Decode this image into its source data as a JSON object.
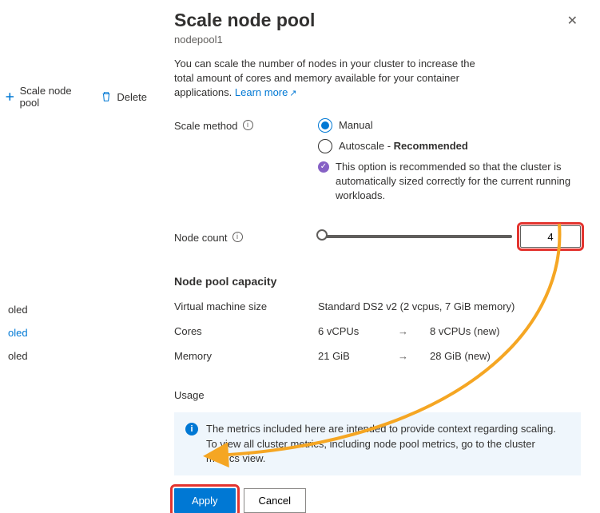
{
  "left": {
    "scale_btn": "Scale node pool",
    "delete_btn": "Delete",
    "items": [
      "oled",
      "oled",
      "oled"
    ]
  },
  "panel": {
    "title": "Scale node pool",
    "subtitle": "nodepool1",
    "desc_pre": "You can scale the number of nodes in your cluster to increase the total amount of cores and memory available for your container applications. ",
    "learn_more": "Learn more",
    "scale_method_label": "Scale method",
    "radio_manual": "Manual",
    "radio_autoscale_pre": "Autoscale - ",
    "radio_autoscale_bold": "Recommended",
    "rec_text": "This option is recommended so that the cluster is automatically sized correctly for the current running workloads.",
    "node_count_label": "Node count",
    "node_count_value": "4",
    "capacity_title": "Node pool capacity",
    "vm_label": "Virtual machine size",
    "vm_value": "Standard DS2 v2 (2 vcpus, 7 GiB memory)",
    "cores_label": "Cores",
    "cores_val": "6 vCPUs",
    "cores_new": "8 vCPUs (new)",
    "mem_label": "Memory",
    "mem_val": "21 GiB",
    "mem_new": "28 GiB (new)",
    "usage_title": "Usage",
    "info_text": "The metrics included here are intended to provide context regarding scaling. To view all cluster metrics, including node pool metrics, go to the cluster metrics view.",
    "apply": "Apply",
    "cancel": "Cancel"
  }
}
